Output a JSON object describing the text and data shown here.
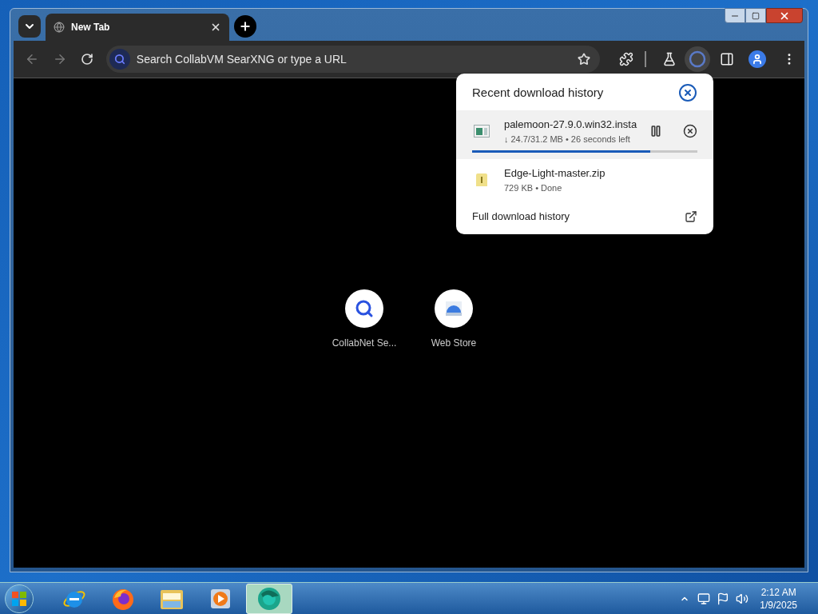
{
  "tabs": [
    {
      "title": "New Tab",
      "selected": true
    }
  ],
  "address_bar": {
    "placeholder": "Search CollabVM SearXNG or type a URL"
  },
  "downloads_panel": {
    "title": "Recent download history",
    "items": [
      {
        "kind": "in_progress",
        "name": "palemoon-27.9.0.win32.insta",
        "status": "↓ 24.7/31.2 MB • 26 seconds left",
        "level": 0.79
      },
      {
        "kind": "done",
        "name": "Edge-Light-master.zip",
        "status": "729 KB • Done"
      }
    ],
    "footer_link": "Full download history"
  },
  "shortcuts": [
    {
      "kind": "search",
      "label": "CollabNet Se..."
    },
    {
      "kind": "store",
      "label": "Web Store"
    }
  ],
  "taskbar": {
    "apps": [
      {
        "kind": "ie",
        "selected": false
      },
      {
        "kind": "firefox",
        "selected": false
      },
      {
        "kind": "explorer",
        "selected": false
      },
      {
        "kind": "media",
        "selected": false
      },
      {
        "kind": "browser",
        "selected": true
      }
    ],
    "clock": {
      "time": "2:12 AM",
      "date": "1/9/2025"
    }
  }
}
